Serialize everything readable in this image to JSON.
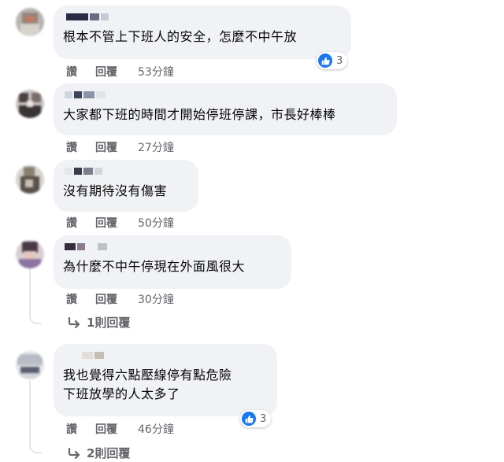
{
  "colors": {
    "bubble_bg": "#f0f2f5",
    "meta_text": "#65676b",
    "like_blue": "#1877f2"
  },
  "comments": [
    {
      "text": "根本不管上下班人的安全，怎麼不中午放",
      "like_label": "讚",
      "reply_label": "回覆",
      "time": "53分鐘",
      "reaction_icon": "thumbs-up-icon",
      "reaction_count": "3"
    },
    {
      "text": "大家都下班的時間才開始停班停課，市長好棒棒",
      "like_label": "讚",
      "reply_label": "回覆",
      "time": "27分鐘"
    },
    {
      "text": "沒有期待沒有傷害",
      "like_label": "讚",
      "reply_label": "回覆",
      "time": "50分鐘"
    },
    {
      "text": "為什麼不中午停現在外面風很大",
      "like_label": "讚",
      "reply_label": "回覆",
      "time": "30分鐘",
      "replies_link": "1則回覆",
      "replies_icon": "reply-arrow-icon"
    },
    {
      "text": "我也覺得六點壓線停有點危險\n下班放學的人太多了",
      "like_label": "讚",
      "reply_label": "回覆",
      "time": "46分鐘",
      "reaction_icon": "thumbs-up-icon",
      "reaction_count": "3",
      "replies_link": "2則回覆",
      "replies_icon": "reply-arrow-icon"
    }
  ]
}
